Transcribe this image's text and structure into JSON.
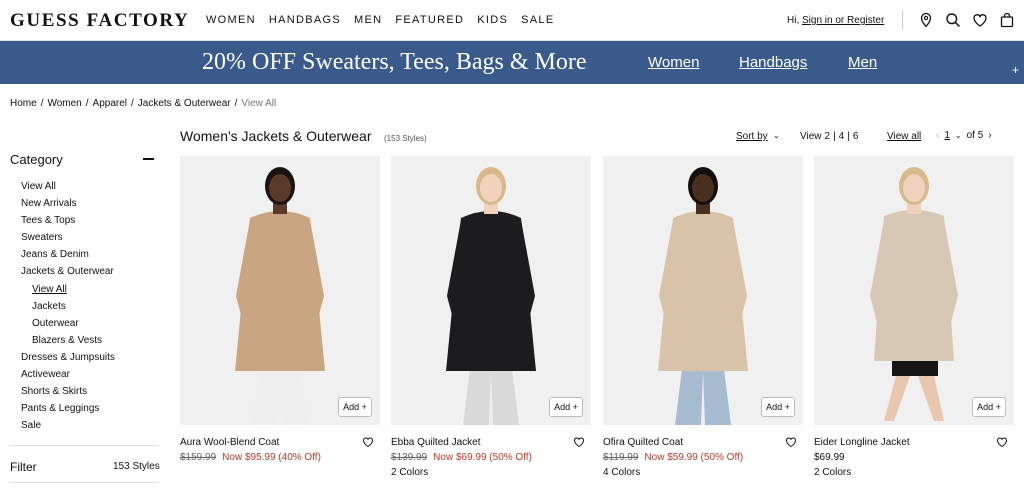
{
  "header": {
    "logo": "GUESS FACTORY",
    "nav": [
      "WOMEN",
      "HANDBAGS",
      "MEN",
      "FEATURED",
      "KIDS",
      "SALE"
    ],
    "greeting": "Hi,",
    "signin": "Sign in or Register",
    "icons": [
      "location-pin-icon",
      "search-icon",
      "heart-icon",
      "shopping-bag-icon"
    ]
  },
  "banner": {
    "promo": "20% OFF Sweaters, Tees, Bags & More",
    "links": [
      "Women",
      "Handbags",
      "Men"
    ],
    "plus": "+",
    "bg_color": "#3a5a8c"
  },
  "breadcrumb": {
    "items": [
      "Home",
      "Women",
      "Apparel",
      "Jackets & Outerwear"
    ],
    "separator": "/",
    "current": "View All"
  },
  "sidebar": {
    "title": "Category",
    "categories": [
      "View All",
      "New Arrivals",
      "Tees & Tops",
      "Sweaters",
      "Jeans & Denim",
      "Jackets & Outerwear",
      "View All",
      "Jackets",
      "Outerwear",
      "Blazers & Vests",
      "Dresses & Jumpsuits",
      "Activewear",
      "Shorts & Skirts",
      "Pants & Leggings",
      "Sale"
    ],
    "filter_label": "Filter",
    "filter_count": "153 Styles"
  },
  "results": {
    "title": "Women's Jackets & Outerwear",
    "count": "(153 Styles)",
    "sort_label": "Sort by",
    "view_label": "View",
    "view_options": [
      "2",
      "|",
      "4",
      "|",
      "6"
    ],
    "view_all": "View all",
    "page": "1",
    "page_of": "of 5"
  },
  "products": [
    {
      "name": "Aura Wool-Blend Coat",
      "orig": "$159.99",
      "sale": "Now $95.99 (40% Off)",
      "colors": "",
      "add": "Add +",
      "coat_color": "#c9a582",
      "skin": "#5a3a28",
      "hair": "#1a1410",
      "pants": "#efefef"
    },
    {
      "name": "Ebba Quilted Jacket",
      "orig": "$139.99",
      "sale": "Now $69.99 (50% Off)",
      "colors": "2 Colors",
      "add": "Add +",
      "coat_color": "#1c1c1e",
      "skin": "#f1d3bd",
      "hair": "#d9b98a",
      "pants": "#d9d9d9"
    },
    {
      "name": "Ofira Quilted Coat",
      "orig": "$119.99",
      "sale": "Now $59.99 (50% Off)",
      "colors": "4 Colors",
      "add": "Add +",
      "coat_color": "#d8c3a9",
      "skin": "#4a2e20",
      "hair": "#151010",
      "pants": "#a8bcd1"
    },
    {
      "name": "Eider Longline Jacket",
      "orig": "",
      "sale": "$69.99",
      "colors": "2 Colors",
      "add": "Add +",
      "coat_color": "#d7c8b6",
      "skin": "#f0d2bc",
      "hair": "#d8b98c",
      "pants": "#151515"
    }
  ]
}
